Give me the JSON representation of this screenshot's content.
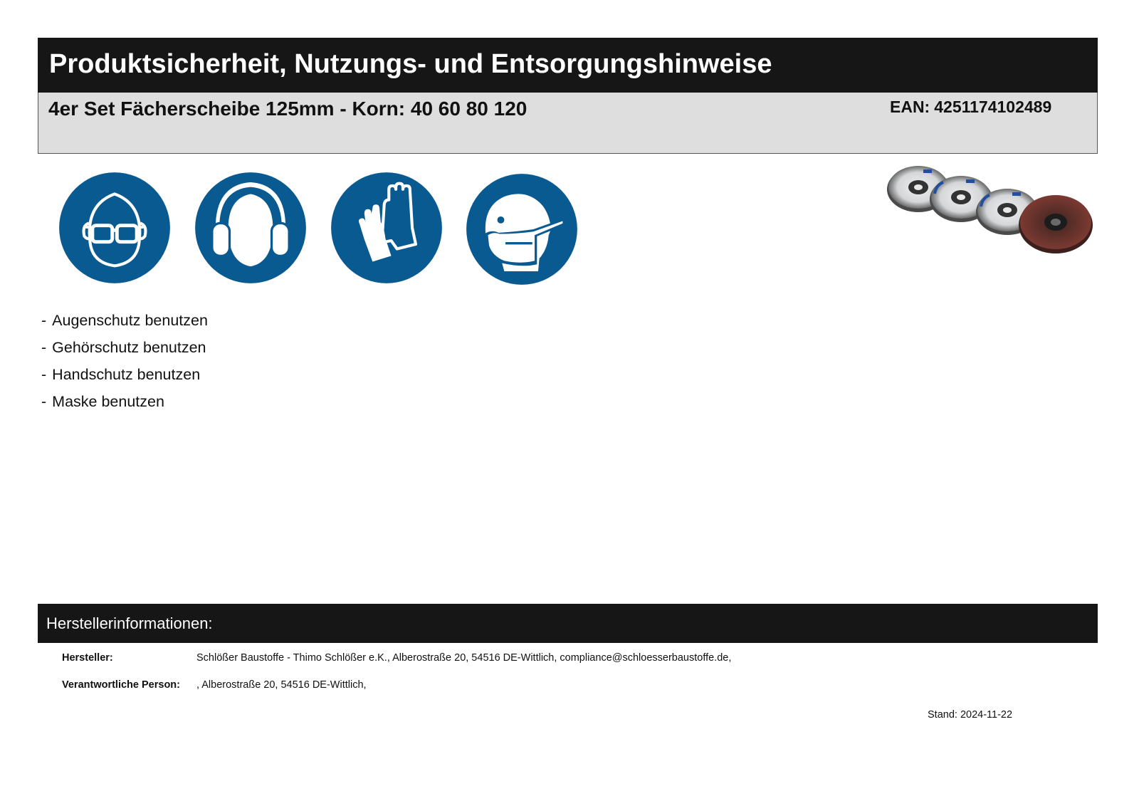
{
  "header": {
    "title": "Produktsicherheit, Nutzungs- und Entsorgungshinweise"
  },
  "product": {
    "name": "4er Set Fächerscheibe 125mm - Korn: 40 60 80 120",
    "ean_label": "EAN:",
    "ean_value": "4251174102489"
  },
  "signs": [
    {
      "icon": "eye-protection-icon"
    },
    {
      "icon": "hearing-protection-icon"
    },
    {
      "icon": "hand-protection-icon"
    },
    {
      "icon": "mask-icon"
    }
  ],
  "colors": {
    "sign_blue": "#0a5a92",
    "header_bg": "#161616",
    "product_bar_bg": "#dedede"
  },
  "hints": [
    {
      "dash": "-",
      "text": "Augenschutz benutzen"
    },
    {
      "dash": "-",
      "text": "Gehörschutz benutzen"
    },
    {
      "dash": "-",
      "text": "Handschutz benutzen"
    },
    {
      "dash": "-",
      "text": "Maske benutzen"
    }
  ],
  "manufacturer_section": {
    "title": "Herstellerinformationen:",
    "maker_label": "Hersteller:",
    "maker_value": "Schlößer Baustoffe - Thimo Schlößer e.K., Alberostraße 20, 54516 DE-Wittlich, compliance@schloesserbaustoffe.de,",
    "person_label": "Verantwortliche Person:",
    "person_value": ", Alberostraße 20, 54516 DE-Wittlich,"
  },
  "stand": "Stand: 2024-11-22"
}
